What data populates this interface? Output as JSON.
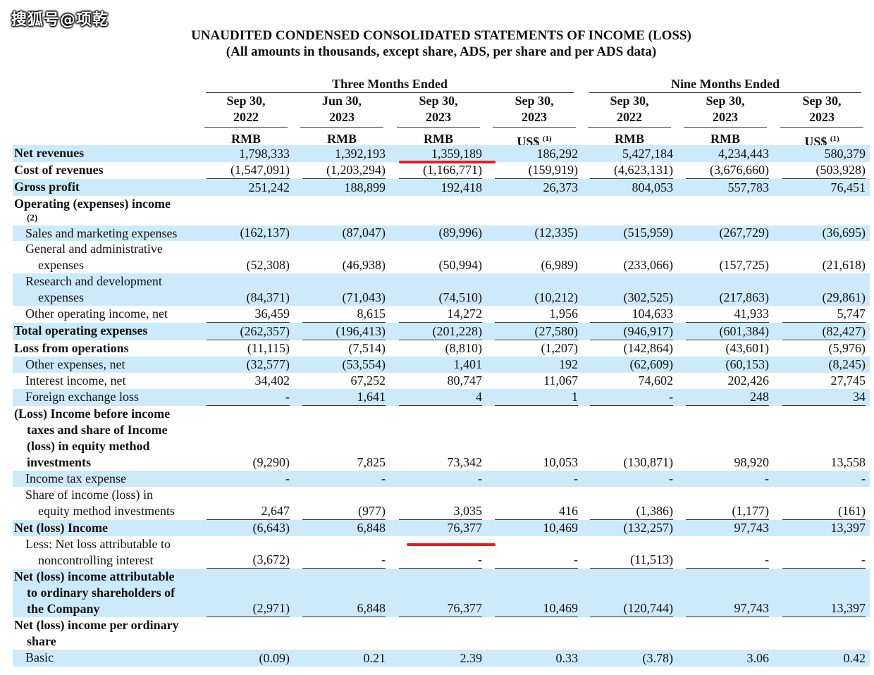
{
  "watermark": "搜狐号@项乾",
  "title": "UNAUDITED CONDENSED CONSOLIDATED STATEMENTS OF INCOME (LOSS)",
  "subtitle": "(All amounts in thousands, except share, ADS, per share and per ADS data)",
  "periods": {
    "three": "Three Months Ended",
    "nine": "Nine Months Ended"
  },
  "columns": [
    {
      "line1": "Sep 30,",
      "line2": "2022",
      "currency": "RMB",
      "sup": ""
    },
    {
      "line1": "Jun 30,",
      "line2": "2023",
      "currency": "RMB",
      "sup": ""
    },
    {
      "line1": "Sep 30,",
      "line2": "2023",
      "currency": "RMB",
      "sup": ""
    },
    {
      "line1": "Sep 30,",
      "line2": "2023",
      "currency": "US$",
      "sup": "(1)"
    },
    {
      "line1": "Sep 30,",
      "line2": "2022",
      "currency": "RMB",
      "sup": ""
    },
    {
      "line1": "Sep 30,",
      "line2": "2023",
      "currency": "RMB",
      "sup": ""
    },
    {
      "line1": "Sep 30,",
      "line2": "2023",
      "currency": "US$",
      "sup": "(1)"
    }
  ],
  "rows": [
    {
      "label": [
        "Net revenues"
      ],
      "bold": true,
      "shade": true,
      "values": [
        "1,798,333",
        "1,392,193",
        "1,359,189",
        "186,292",
        "5,427,184",
        "4,234,443",
        "580,379"
      ]
    },
    {
      "label": [
        "Cost of revenues"
      ],
      "bold": true,
      "shade": false,
      "underline": true,
      "values": [
        "(1,547,091)",
        "(1,203,294)",
        "(1,166,771)",
        "(159,919)",
        "(4,623,131)",
        "(3,676,660)",
        "(503,928)"
      ]
    },
    {
      "label": [
        "Gross profit"
      ],
      "bold": true,
      "shade": true,
      "values": [
        "251,242",
        "188,899",
        "192,418",
        "26,373",
        "804,053",
        "557,783",
        "76,451"
      ]
    },
    {
      "label": [
        "Operating (expenses) income"
      ],
      "labelSmall": "(2)",
      "bold": true,
      "shade": false,
      "values": [
        "",
        "",
        "",
        "",
        "",
        "",
        ""
      ]
    },
    {
      "label": [
        "Sales and marketing expenses"
      ],
      "indent": true,
      "shade": true,
      "values": [
        "(162,137)",
        "(87,047)",
        "(89,996)",
        "(12,335)",
        "(515,959)",
        "(267,729)",
        "(36,695)"
      ]
    },
    {
      "label": [
        "General and administrative",
        "expenses"
      ],
      "indent": true,
      "shade": false,
      "values": [
        "(52,308)",
        "(46,938)",
        "(50,994)",
        "(6,989)",
        "(233,066)",
        "(157,725)",
        "(21,618)"
      ]
    },
    {
      "label": [
        "Research and development",
        "expenses"
      ],
      "indent": true,
      "shade": true,
      "values": [
        "(84,371)",
        "(71,043)",
        "(74,510)",
        "(10,212)",
        "(302,525)",
        "(217,863)",
        "(29,861)"
      ]
    },
    {
      "label": [
        "Other operating income, net"
      ],
      "indent": true,
      "shade": false,
      "underline": true,
      "values": [
        "36,459",
        "8,615",
        "14,272",
        "1,956",
        "104,633",
        "41,933",
        "5,747"
      ]
    },
    {
      "label": [
        "Total operating expenses"
      ],
      "bold": true,
      "shade": true,
      "underline": true,
      "values": [
        "(262,357)",
        "(196,413)",
        "(201,228)",
        "(27,580)",
        "(946,917)",
        "(601,384)",
        "(82,427)"
      ]
    },
    {
      "label": [
        "Loss from operations"
      ],
      "bold": true,
      "shade": false,
      "values": [
        "(11,115)",
        "(7,514)",
        "(8,810)",
        "(1,207)",
        "(142,864)",
        "(43,601)",
        "(5,976)"
      ]
    },
    {
      "label": [
        "Other expenses, net"
      ],
      "indent": true,
      "shade": true,
      "values": [
        "(32,577)",
        "(53,554)",
        "1,401",
        "192",
        "(62,609)",
        "(60,153)",
        "(8,245)"
      ]
    },
    {
      "label": [
        "Interest income, net"
      ],
      "indent": true,
      "shade": false,
      "values": [
        "34,402",
        "67,252",
        "80,747",
        "11,067",
        "74,602",
        "202,426",
        "27,745"
      ]
    },
    {
      "label": [
        "Foreign exchange loss"
      ],
      "indent": true,
      "shade": true,
      "underline": true,
      "values": [
        "-",
        "1,641",
        "4",
        "1",
        "-",
        "248",
        "34"
      ]
    },
    {
      "label": [
        "(Loss) Income before income",
        "taxes and share of Income",
        "(loss) in equity method",
        "investments"
      ],
      "bold": true,
      "shade": false,
      "values": [
        "(9,290)",
        "7,825",
        "73,342",
        "10,053",
        "(130,871)",
        "98,920",
        "13,558"
      ]
    },
    {
      "label": [
        "Income tax expense"
      ],
      "indent": true,
      "shade": true,
      "values": [
        "-",
        "-",
        "-",
        "-",
        "-",
        "-",
        "-"
      ]
    },
    {
      "label": [
        "Share of income (loss) in",
        "equity method investments"
      ],
      "indent": true,
      "shade": false,
      "underline": true,
      "values": [
        "2,647",
        "(977)",
        "3,035",
        "416",
        "(1,386)",
        "(1,177)",
        "(161)"
      ]
    },
    {
      "label": [
        "Net (loss) Income"
      ],
      "bold": true,
      "shade": true,
      "values": [
        "(6,643)",
        "6,848",
        "76,377",
        "10,469",
        "(132,257)",
        "97,743",
        "13,397"
      ]
    },
    {
      "label": [
        "Less: Net loss attributable to",
        "noncontrolling interest"
      ],
      "indent": true,
      "shade": false,
      "underline": true,
      "values": [
        "(3,672)",
        "-",
        "-",
        "-",
        "(11,513)",
        "-",
        "-"
      ]
    },
    {
      "label": [
        "Net (loss) income attributable",
        "to ordinary shareholders of",
        "the Company"
      ],
      "bold": true,
      "shade": true,
      "underline": true,
      "values": [
        "(2,971)",
        "6,848",
        "76,377",
        "10,469",
        "(120,744)",
        "97,743",
        "13,397"
      ]
    },
    {
      "label": [
        "Net (loss) income per ordinary",
        "share"
      ],
      "bold": true,
      "shade": false,
      "values": [
        "",
        "",
        "",
        "",
        "",
        "",
        ""
      ]
    },
    {
      "label": [
        "Basic"
      ],
      "indent": true,
      "shade": true,
      "values": [
        "(0.09)",
        "0.21",
        "2.39",
        "0.33",
        "(3.78)",
        "3.06",
        "0.42"
      ]
    }
  ]
}
